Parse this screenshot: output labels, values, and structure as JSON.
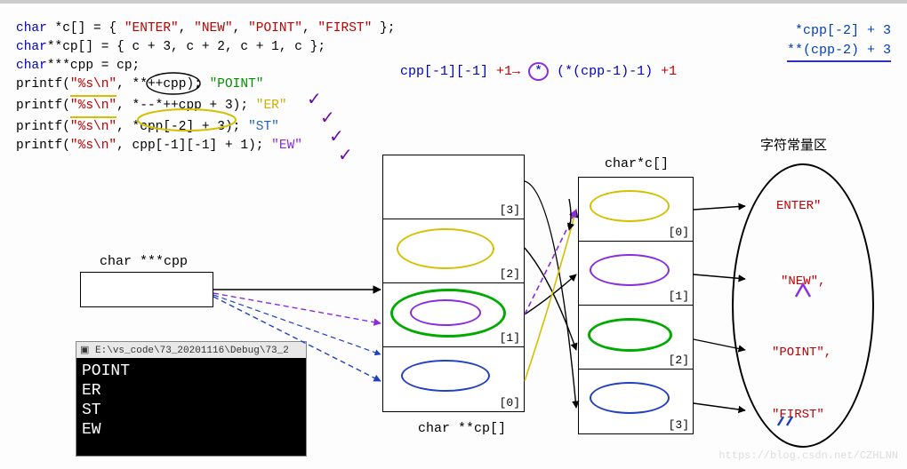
{
  "code": {
    "line1_a": "char",
    "line1_b": " *c[] = { ",
    "line1_s1": "\"ENTER\"",
    "line1_s2": "\"NEW\"",
    "line1_s3": "\"POINT\"",
    "line1_s4": "\"FIRST\"",
    "line1_c": " };",
    "line2_a": "char",
    "line2_b": "**cp[] = { c + 3, c + 2, c + 1, c };",
    "line3_a": "char",
    "line3_b": "***cpp = cp;",
    "line4_a": "printf(",
    "line4_s": "\"%s\\n\"",
    "line4_b": ", **++cpp);",
    "line4_c": "\"POINT\"",
    "line5_a": "printf(",
    "line5_s": "\"%s\\n\"",
    "line5_b": ", *--*++cpp + 3);",
    "line5_c": "\"ER\"",
    "line6_a": "printf(",
    "line6_s": "\"%s\\n\"",
    "line6_b": ", *cpp[-2] + 3); ",
    "line6_c": "\"ST\"",
    "line7_a": "printf(",
    "line7_s": "\"%s\\n\"",
    "line7_b": ", cpp[-1][-1] + 1);",
    "line7_c": "\"EW\""
  },
  "right_notes": {
    "e1": "*cpp[-2] + 3",
    "e2": "**(cpp-2) + 3"
  },
  "center_expr": {
    "a": "cpp[-1][-1]",
    "b": "+1→",
    "c": "*",
    "d": "(*(cpp-1)-1)",
    "e": "+1"
  },
  "labels": {
    "cpp_box": "char ***cpp",
    "cp_arr": "char **cp[]",
    "c_arr": "char*c[]",
    "const_area": "字符常量区"
  },
  "cp_indices": [
    "[3]",
    "[2]",
    "[1]",
    "[0]"
  ],
  "c_indices": [
    "[0]",
    "[1]",
    "[2]",
    "[3]"
  ],
  "constants": {
    "c0": "ENTER\"",
    "c1": "\"NEW\",",
    "c2": "\"POINT\",",
    "c3": "\"FIRST\""
  },
  "console": {
    "title": "E:\\vs_code\\73_20201116\\Debug\\73_2",
    "l1": "POINT",
    "l2": "ER",
    "l3": "ST",
    "l4": "EW"
  },
  "watermark": "https://blog.csdn.net/CZHLNN",
  "chart_data": {
    "type": "diagram",
    "description": "C pointer-to-pointer array traversal showing char *c[], char **cp[], char ***cpp memory layout and dereferencing",
    "char_star_c": [
      "ENTER",
      "NEW",
      "POINT",
      "FIRST"
    ],
    "char_starstar_cp": [
      "c+3",
      "c+2",
      "c+1",
      "c"
    ],
    "cp_points_to_c_index": [
      3,
      2,
      1,
      0
    ],
    "expressions": [
      {
        "expr": "**++cpp",
        "result": "POINT"
      },
      {
        "expr": "*--*++cpp + 3",
        "result": "ER"
      },
      {
        "expr": "*cpp[-2] + 3",
        "result": "ST"
      },
      {
        "expr": "cpp[-1][-1] + 1",
        "result": "EW"
      }
    ],
    "equivalences": [
      "*cpp[-2] + 3  ==  **(cpp-2) + 3",
      "cpp[-1][-1]  ==  *(*(cpp-1)-1)"
    ]
  }
}
